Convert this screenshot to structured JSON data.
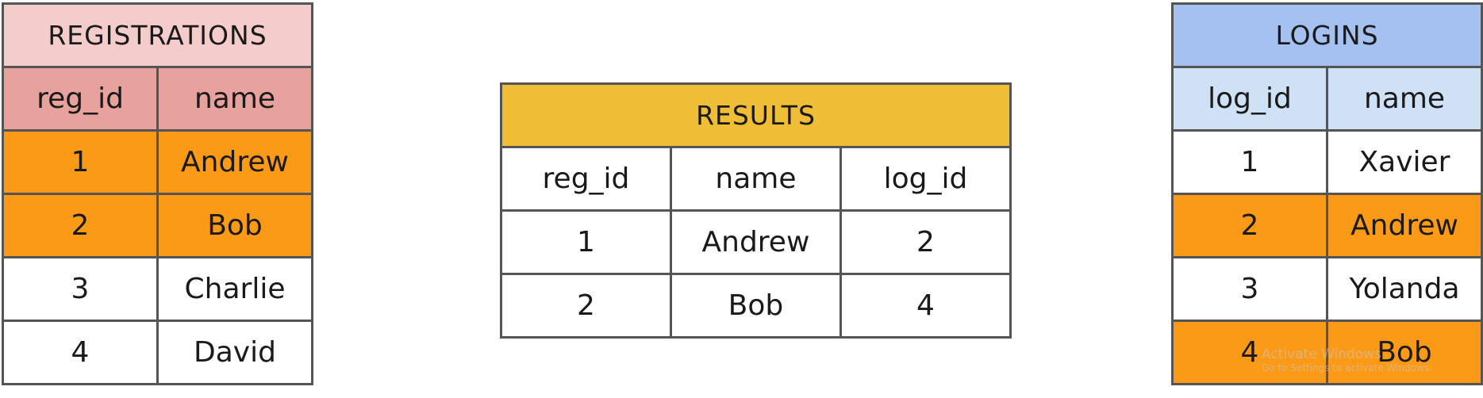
{
  "registrations": {
    "title": "REGISTRATIONS",
    "columns": [
      "reg_id",
      "name"
    ],
    "rows": [
      {
        "reg_id": "1",
        "name": "Andrew",
        "highlighted": true
      },
      {
        "reg_id": "2",
        "name": "Bob",
        "highlighted": true
      },
      {
        "reg_id": "3",
        "name": "Charlie",
        "highlighted": false
      },
      {
        "reg_id": "4",
        "name": "David",
        "highlighted": false
      }
    ]
  },
  "results": {
    "title": "RESULTS",
    "columns": [
      "reg_id",
      "name",
      "log_id"
    ],
    "rows": [
      {
        "reg_id": "1",
        "name": "Andrew",
        "log_id": "2"
      },
      {
        "reg_id": "2",
        "name": "Bob",
        "log_id": "4"
      }
    ]
  },
  "logins": {
    "title": "LOGINS",
    "columns": [
      "log_id",
      "name"
    ],
    "rows": [
      {
        "log_id": "1",
        "name": "Xavier",
        "highlighted": false
      },
      {
        "log_id": "2",
        "name": "Andrew",
        "highlighted": true
      },
      {
        "log_id": "3",
        "name": "Yolanda",
        "highlighted": false
      },
      {
        "log_id": "4",
        "name": "Bob",
        "highlighted": true
      }
    ]
  },
  "colors": {
    "registrations_title_bg": "#f5cccc",
    "registrations_header_bg": "#e8a29d",
    "results_title_bg": "#f0be36",
    "logins_title_bg": "#a4c1f0",
    "logins_header_bg": "#cfe1f5",
    "match_highlight": "#fb9a17",
    "border": "#555555"
  },
  "watermark": {
    "title": "Activate Windows",
    "subtitle": "Go to Settings to activate Windows."
  }
}
